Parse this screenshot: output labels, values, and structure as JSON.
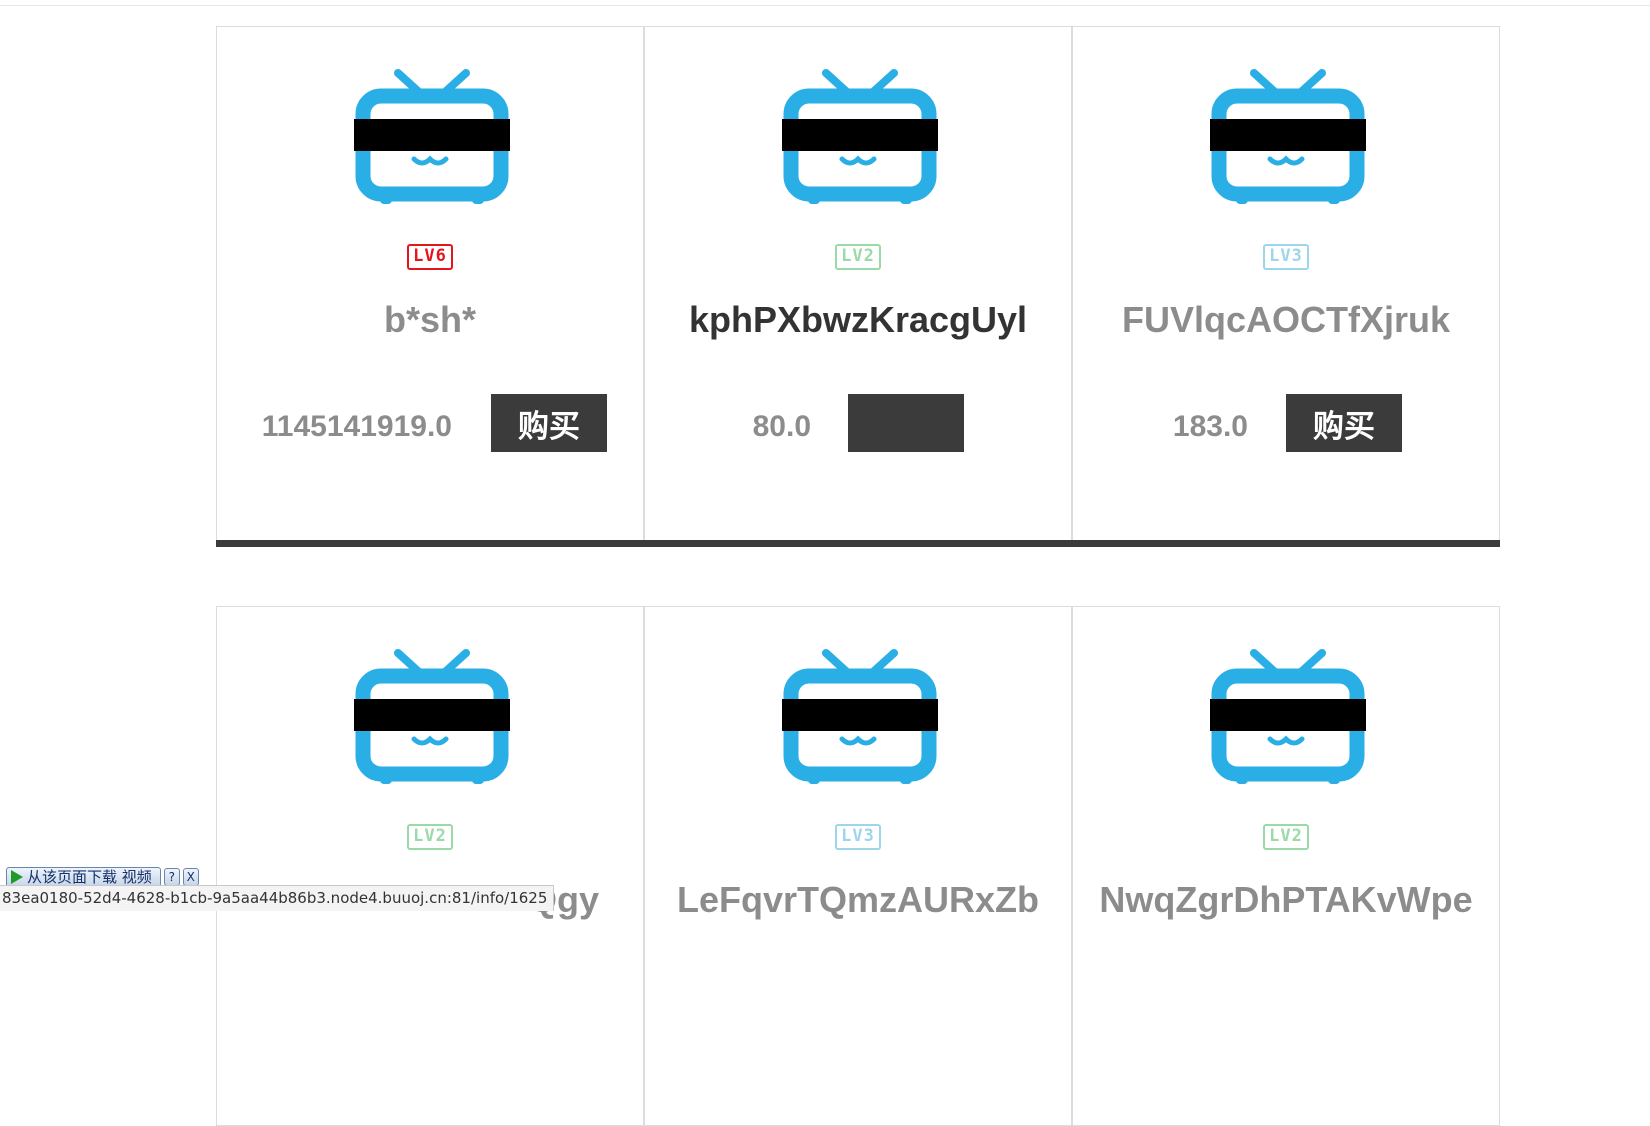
{
  "items": [
    {
      "level": "LV6",
      "level_color": "#e8141c",
      "username": "b*sh*",
      "username_dark": false,
      "price": "1145141919.0",
      "buy_label": "购买"
    },
    {
      "level": "LV2",
      "level_color": "#9ad9a8",
      "username": "kphPXbwzKracgUyl",
      "username_dark": true,
      "price": "80.0",
      "buy_label": ""
    },
    {
      "level": "LV3",
      "level_color": "#9fd5ea",
      "username": "FUVlqcAOCTfXjruk",
      "username_dark": false,
      "price": "183.0",
      "buy_label": "购买"
    },
    {
      "level": "LV2",
      "level_color": "#9ad9a8",
      "username": "Qgy",
      "username_dark": false,
      "price": "",
      "buy_label": ""
    },
    {
      "level": "LV3",
      "level_color": "#9fd5ea",
      "username": "LeFqvrTQmzAURxZb",
      "username_dark": false,
      "price": "",
      "buy_label": ""
    },
    {
      "level": "LV2",
      "level_color": "#9ad9a8",
      "username": "NwqZgrDhPTAKvWpe",
      "username_dark": false,
      "price": "",
      "buy_label": ""
    }
  ],
  "icon": {
    "name": "tv-avatar-icon",
    "color": "#2aaee6",
    "redaction_color": "#000000"
  },
  "download_widget": {
    "label": "从该页面下载 视频",
    "help": "?",
    "close": "X"
  },
  "status_bar": {
    "url": "83ea0180-52d4-4628-b1cb-9a5aa44b86b3.node4.buuoj.cn:81/info/1625"
  }
}
